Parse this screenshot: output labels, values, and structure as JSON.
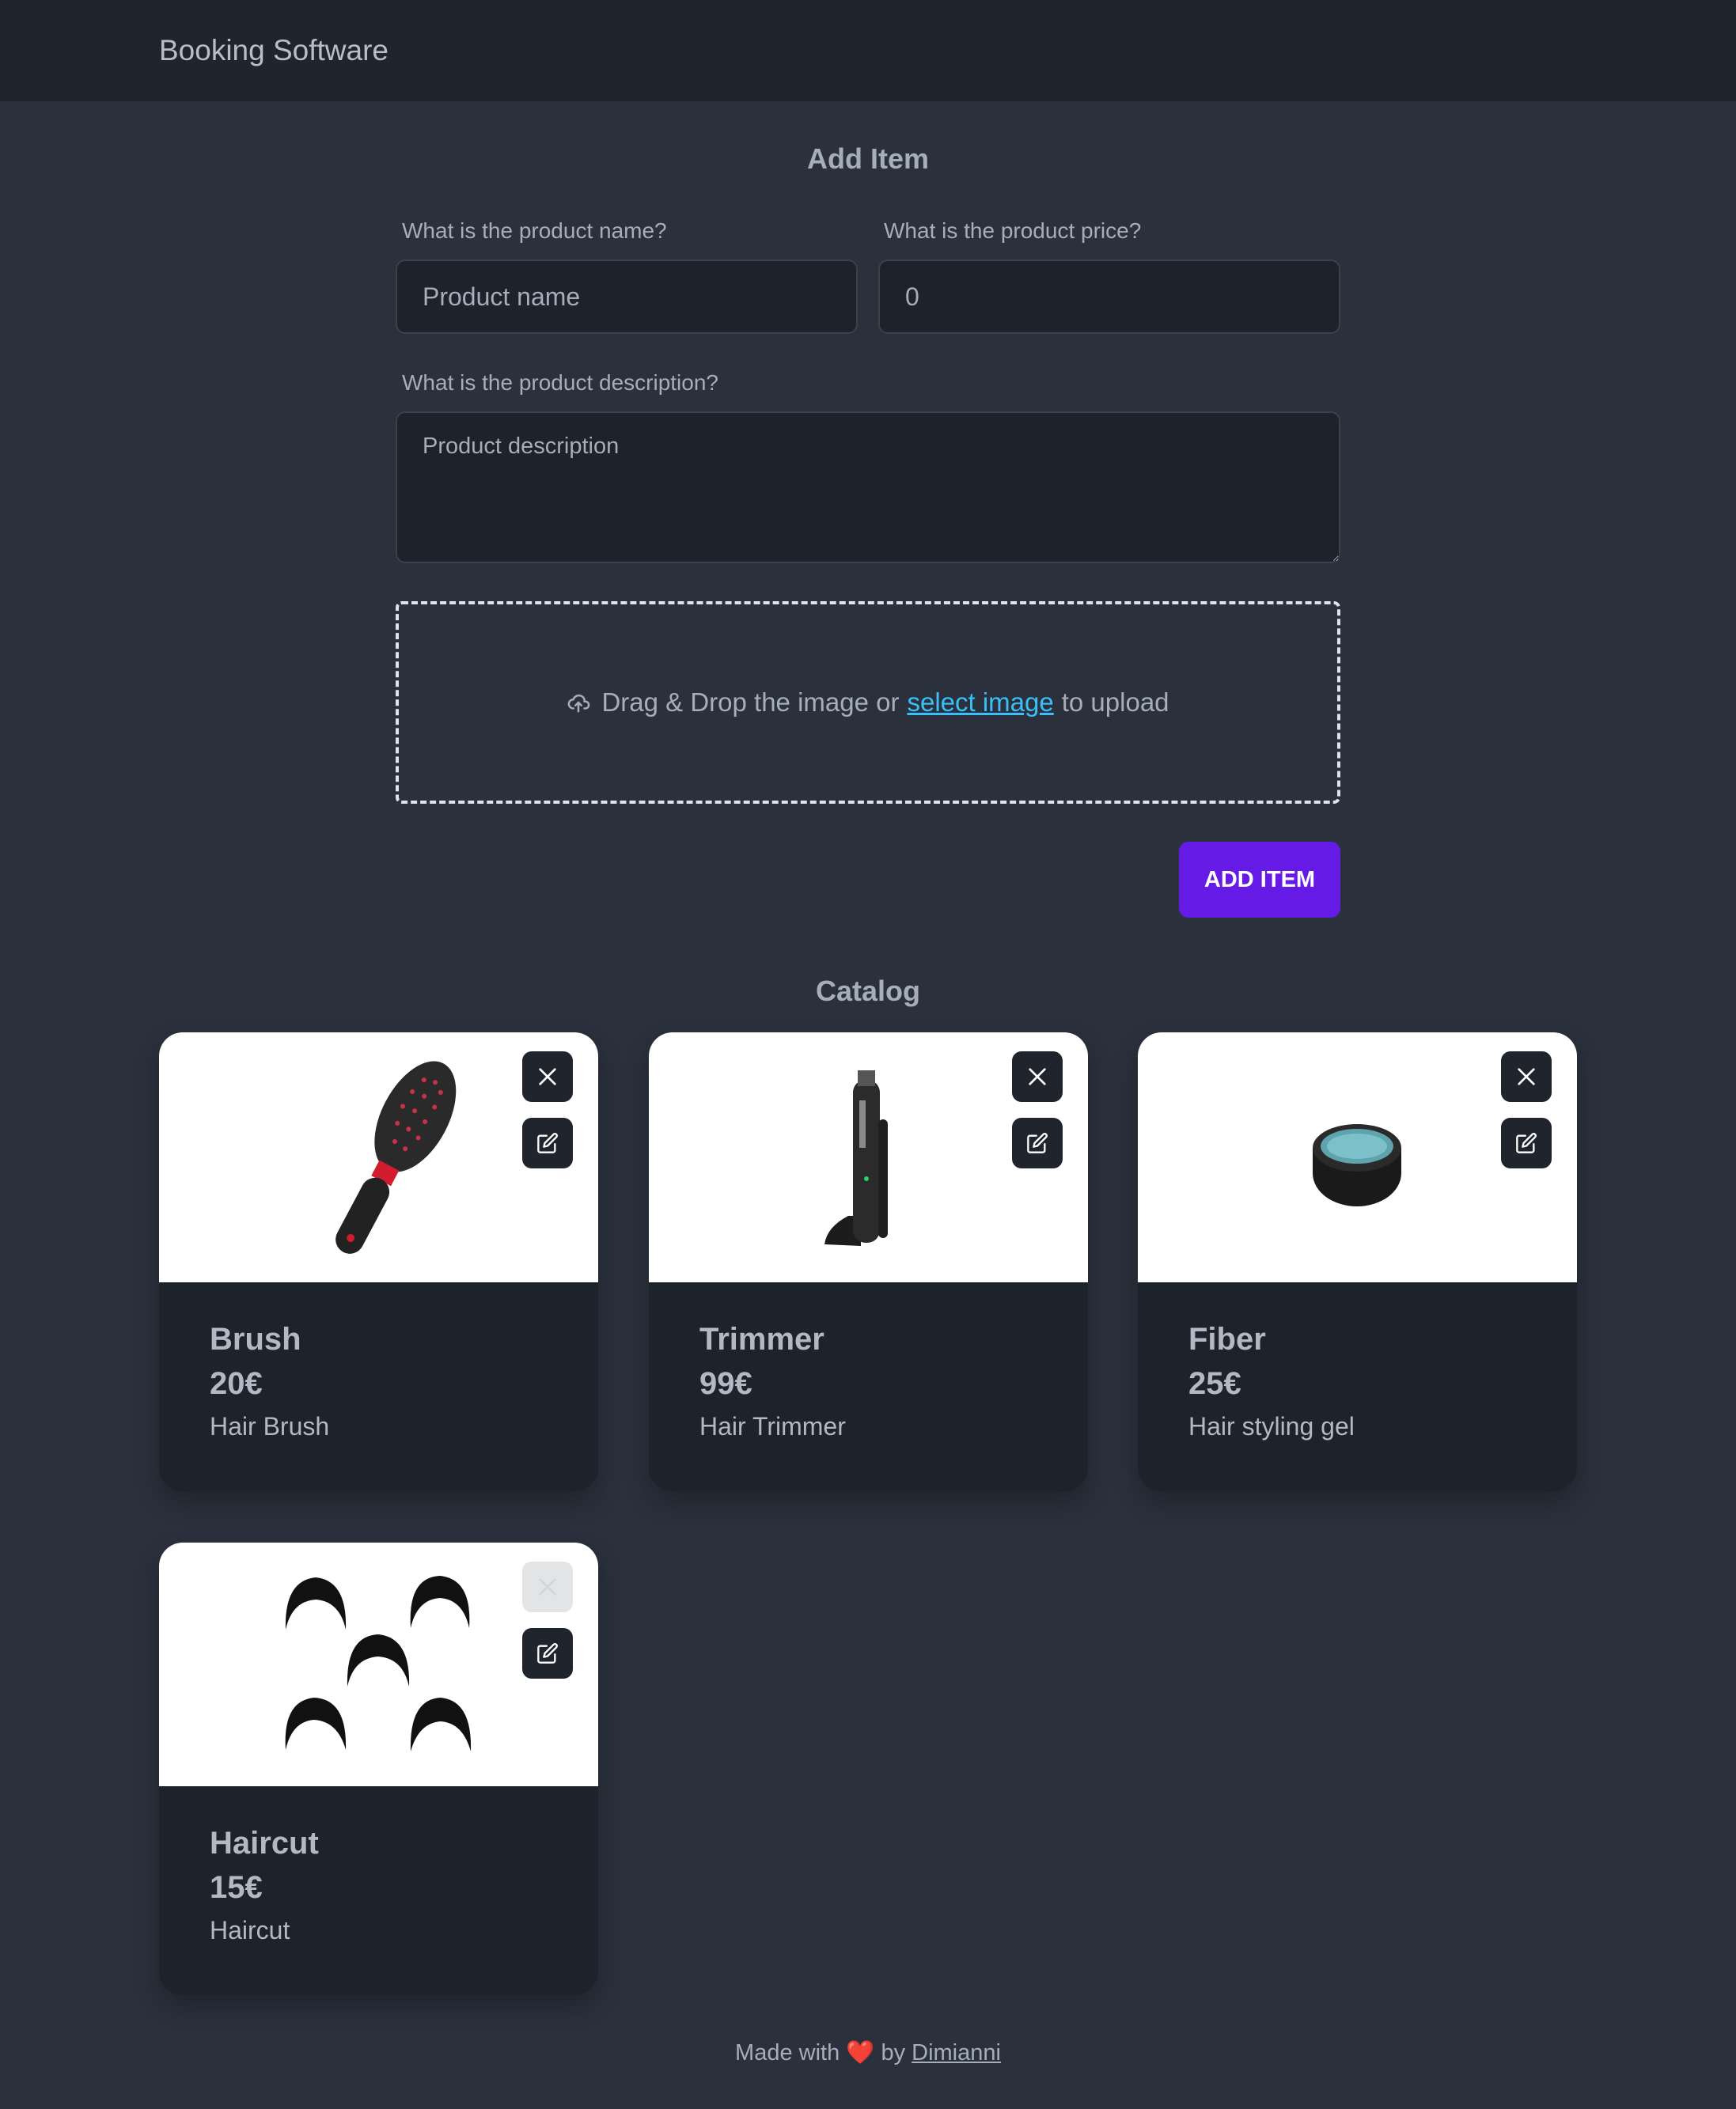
{
  "navbar": {
    "brand": "Booking Software"
  },
  "form": {
    "title": "Add Item",
    "name_label": "What is the product name?",
    "name_placeholder": "Product name",
    "price_label": "What is the product price?",
    "price_value": "0",
    "description_label": "What is the product description?",
    "description_placeholder": "Product description",
    "dropzone": {
      "icon": "cloud-upload-icon",
      "text_before": "Drag & Drop the image or",
      "link_text": "select image",
      "text_after": "to upload"
    },
    "submit_label": "ADD ITEM"
  },
  "catalog": {
    "title": "Catalog",
    "items": [
      {
        "name": "Brush",
        "price": "20€",
        "description": "Hair Brush",
        "image_icon": "hair-brush-image",
        "delete_enabled": true
      },
      {
        "name": "Trimmer",
        "price": "99€",
        "description": "Hair Trimmer",
        "image_icon": "hair-trimmer-image",
        "delete_enabled": true
      },
      {
        "name": "Fiber",
        "price": "25€",
        "description": "Hair styling gel",
        "image_icon": "styling-fiber-jar-image",
        "delete_enabled": true
      },
      {
        "name": "Haircut",
        "price": "15€",
        "description": "Haircut",
        "image_icon": "haircut-styles-image",
        "delete_enabled": false
      }
    ]
  },
  "footer": {
    "text_before": "Made with",
    "heart": "❤️",
    "text_by": "by",
    "author": "Dimianni"
  },
  "colors": {
    "background": "#2a303c",
    "navbar": "#1f242d",
    "accent": "#661ae6",
    "link": "#3abff8"
  }
}
